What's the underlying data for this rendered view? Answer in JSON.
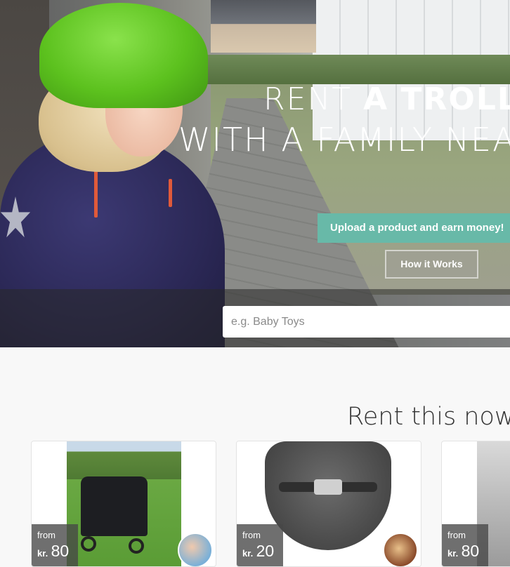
{
  "hero": {
    "title_light": "RENT ",
    "title_bold": "A TROLLEY",
    "title_line2": "WITH A FAMILY NEAR YOU",
    "upload_button": "Upload a product and earn money!",
    "how_button": "How it Works"
  },
  "search": {
    "placeholder": "e.g. Baby Toys"
  },
  "section": {
    "title": "Rent this now"
  },
  "products": [
    {
      "from_label": "from",
      "currency": "kr.",
      "price": "80",
      "image": "double-stroller"
    },
    {
      "from_label": "from",
      "currency": "kr.",
      "price": "20",
      "image": "bouncer-seat"
    },
    {
      "from_label": "from",
      "currency": "kr.",
      "price": "80",
      "image": "stroller"
    }
  ],
  "colors": {
    "upload_button": "#68b9a8",
    "page_background": "#f8f8f8",
    "helmet_green": "#5cc11e"
  }
}
